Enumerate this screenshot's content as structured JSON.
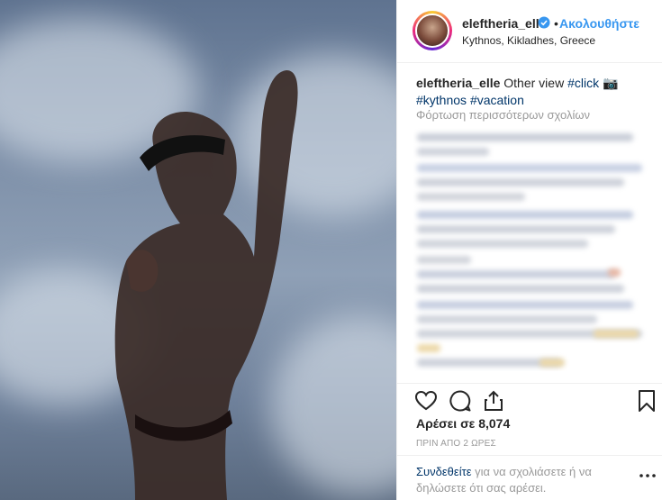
{
  "post": {
    "username": "eleftheria_elle",
    "follow_label": "Ακολουθήστε",
    "dot": "•",
    "location": "Kythnos, Kikladhes, Greece",
    "caption": {
      "user": "eleftheria_elle",
      "text": "Other view",
      "tag1": "#click",
      "camera": "📷",
      "tag2": "#kythnos",
      "tag3": "#vacation"
    },
    "load_more": "Φόρτωση περισσότερων σχολίων",
    "likes": "Αρέσει σε 8,074",
    "timestamp": "ΠΡΙΝ ΑΠΟ 2 ΩΡΕΣ",
    "login_link": "Συνδεθείτε",
    "login_text": "για να σχολιάσετε ή να δηλώσετε ότι σας αρέσει."
  },
  "colors": {
    "accent": "#3897f0",
    "hashtag": "#003569",
    "muted": "#999999",
    "verified": "#3897f0"
  },
  "icons": [
    "verified-icon",
    "heart-icon",
    "comment-icon",
    "share-icon",
    "bookmark-icon",
    "more-icon"
  ]
}
